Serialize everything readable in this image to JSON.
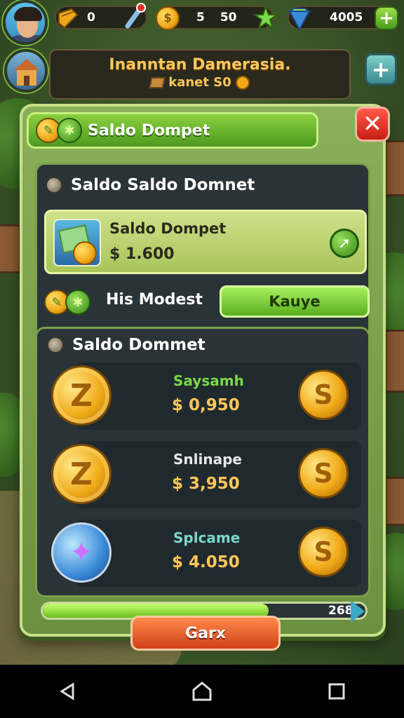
{
  "hud": {
    "slot1_value": "0",
    "slot2_values": [
      "5",
      "50"
    ],
    "gem_value": "4005",
    "plus_label": "+"
  },
  "banner": {
    "title": "Inanntan Damerasia.",
    "subtitle": "kanet S0"
  },
  "panel": {
    "header_title": "Saldo Dompet",
    "close_label": "✕",
    "section1_title": "Saldo Saldo Domnet",
    "wallet": {
      "label": "Saldo Dompet",
      "amount": "$ 1.600"
    },
    "model_row": {
      "label": "His Modest",
      "button": "Kauye"
    },
    "section2_title": "Saldo Dommet",
    "items": [
      {
        "name": "Saysamh",
        "price": "0,950",
        "icon": "gold-coin",
        "glyph": "Z",
        "name_color": "#7ad84a"
      },
      {
        "name": "Snlinape",
        "price": "3,950",
        "icon": "gold-coin",
        "glyph": "Z",
        "name_color": "#e8e8e8"
      },
      {
        "name": "Splcame",
        "price": "4.050",
        "icon": "blue-gem",
        "glyph": "✦",
        "name_color": "#7ad8c8"
      }
    ],
    "progress": {
      "value": 0.7,
      "label": "268"
    },
    "action_button": "Garx"
  },
  "colors": {
    "accent_green": "#5aae1e",
    "gold": "#ffc75a",
    "danger": "#d0401a"
  }
}
